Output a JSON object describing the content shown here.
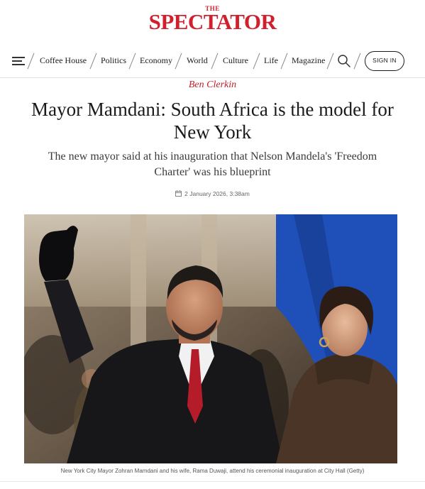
{
  "masthead": {
    "the": "THE",
    "name": "SPECTATOR"
  },
  "nav": {
    "items": [
      "Coffee House",
      "Politics",
      "Economy",
      "World",
      "Culture",
      "Life",
      "Magazine"
    ],
    "signin_label": "SIGN IN"
  },
  "article": {
    "author": "Ben Clerkin",
    "headline": "Mayor Mamdani: South Africa is the model for New York",
    "standfirst": "The new mayor said at his inauguration that Nelson Mandela's 'Freedom Charter' was his blueprint",
    "date": "2 January 2026, 3:38am",
    "caption": "New York City Mayor Zohran Mamdani and his wife, Rama Duwaji, attend his ceremonial inauguration at City Hall (Getty)"
  },
  "colors": {
    "brand_red": "#d0202e",
    "author_red": "#c41e2a",
    "flag_blue": "#1f4fb8"
  },
  "icons": [
    "hamburger-menu-icon",
    "search-icon",
    "calendar-icon"
  ]
}
